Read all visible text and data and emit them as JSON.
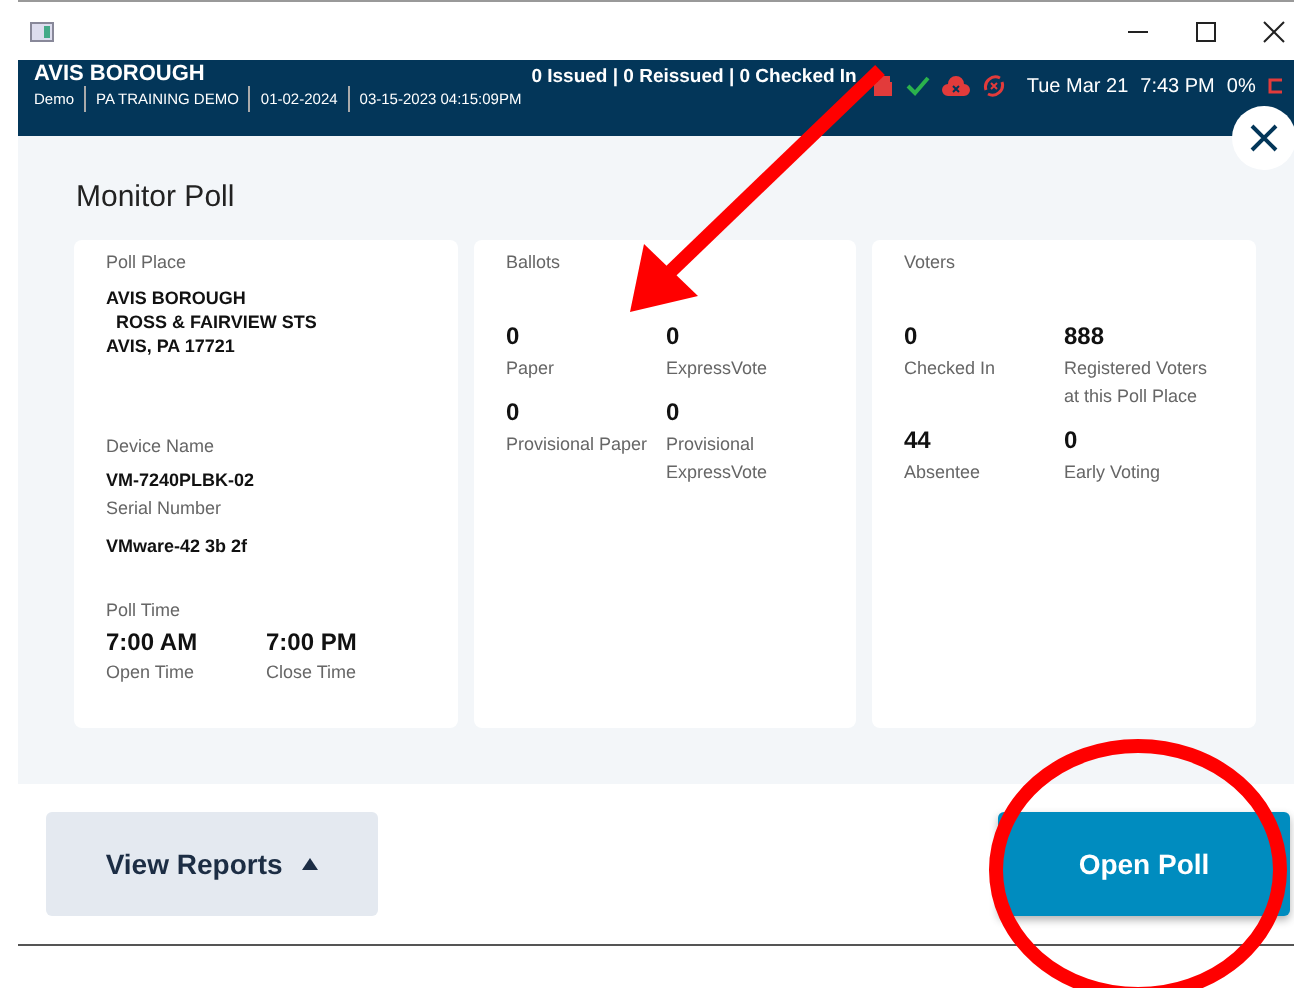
{
  "header": {
    "site": "AVIS BOROUGH",
    "details": [
      "Demo",
      "PA TRAINING DEMO",
      "01-02-2024",
      "03-15-2023 04:15:09PM"
    ],
    "counts": "0 Issued | 0 Reissued | 0 Checked In",
    "date": "Tue Mar 21",
    "time": "7:43 PM",
    "battery": "0%"
  },
  "title": "Monitor Poll",
  "poll_place": {
    "label": "Poll Place",
    "address": [
      "AVIS BOROUGH",
      "  ROSS & FAIRVIEW STS",
      "AVIS, PA 17721"
    ],
    "device_label": "Device Name",
    "device": "VM-7240PLBK-02",
    "serial_label": "Serial Number",
    "serial": "VMware-42 3b 2f",
    "time_label": "Poll Time",
    "times": [
      {
        "value": "7:00 AM",
        "label": "Open Time"
      },
      {
        "value": "7:00 PM",
        "label": "Close Time"
      }
    ]
  },
  "ballots": {
    "label": "Ballots",
    "stats": [
      {
        "value": "0",
        "label": "Paper"
      },
      {
        "value": "0",
        "label": "ExpressVote"
      },
      {
        "value": "0",
        "label": "Provisional Paper"
      },
      {
        "value": "0",
        "label": "Provisional ExpressVote"
      }
    ]
  },
  "voters": {
    "label": "Voters",
    "stats": [
      {
        "value": "0",
        "label": "Checked In"
      },
      {
        "value": "888",
        "label": "Registered Voters at this Poll Place"
      },
      {
        "value": "44",
        "label": "Absentee"
      },
      {
        "value": "0",
        "label": "Early Voting"
      }
    ]
  },
  "buttons": [
    {
      "label": "View Reports",
      "kind": "menu"
    },
    {
      "label": "Open Poll",
      "kind": "primary"
    }
  ]
}
